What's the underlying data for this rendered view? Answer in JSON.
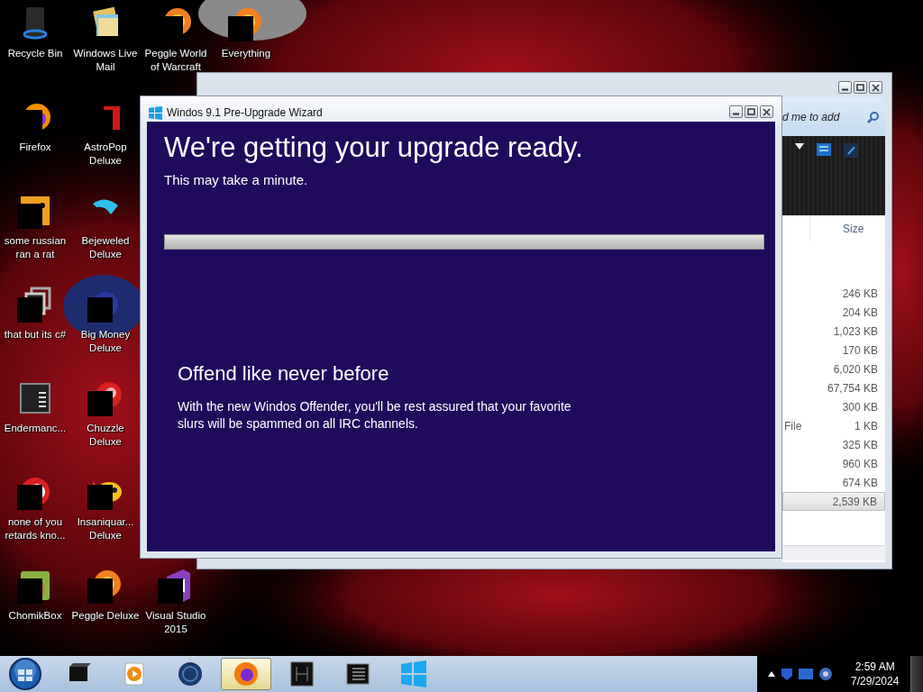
{
  "desktop_icons": [
    [
      {
        "label": "Recycle Bin",
        "kind": "bin",
        "censored": false
      },
      {
        "label": "Windows Live Mail",
        "kind": "mail",
        "censored": false
      },
      {
        "label": "Peggle World of Warcraft",
        "kind": "ring",
        "censored": true
      },
      {
        "label": "Everything",
        "kind": "ring",
        "censored": true
      }
    ],
    [
      {
        "label": "Firefox",
        "kind": "fox",
        "censored": true
      },
      {
        "label": "AstroPop Deluxe",
        "kind": "astro",
        "censored": true
      }
    ],
    [
      {
        "label": "some russian ran a rat",
        "kind": "rat",
        "censored": true
      },
      {
        "label": "Bejeweled Deluxe",
        "kind": "gem",
        "censored": false
      }
    ],
    [
      {
        "label": "that but its c#",
        "kind": "stack",
        "censored": true
      },
      {
        "label": "Big Money Deluxe",
        "kind": "blob",
        "censored": true
      }
    ],
    [
      {
        "label": "Endermanc...",
        "kind": "term",
        "censored": false
      },
      {
        "label": "Chuzzle Deluxe",
        "kind": "red",
        "censored": true
      }
    ],
    [
      {
        "label": "none of you retards kno...",
        "kind": "swirl",
        "censored": true
      },
      {
        "label": "Insaniquar... Deluxe",
        "kind": "fish",
        "censored": true
      }
    ],
    [
      {
        "label": "ChomikBox",
        "kind": "hamster",
        "censored": true
      },
      {
        "label": "Peggle Deluxe",
        "kind": "ring",
        "censored": true
      },
      {
        "label": "Visual Studio 2015",
        "kind": "vs",
        "censored": true
      }
    ]
  ],
  "explorer": {
    "search": {
      "placeholder": "d me to add"
    },
    "columns": [
      "Size"
    ],
    "rows": [
      {
        "size": "246 KB",
        "selected": false
      },
      {
        "size": "204 KB",
        "selected": false
      },
      {
        "size": "1,023 KB",
        "selected": false
      },
      {
        "size": "170 KB",
        "selected": false
      },
      {
        "size": "6,020 KB",
        "selected": false
      },
      {
        "size": "67,754 KB",
        "selected": false
      },
      {
        "size": "300 KB",
        "selected": false
      },
      {
        "column_2": "File",
        "size": "1 KB",
        "selected": false
      },
      {
        "size": "325 KB",
        "selected": false
      },
      {
        "size": "960 KB",
        "selected": false
      },
      {
        "size": "674 KB",
        "selected": false
      },
      {
        "size": "2,539 KB",
        "selected": true
      }
    ]
  },
  "wizard": {
    "title": "Windos 9.1 Pre-Upgrade Wizard",
    "heading": "We're getting your upgrade ready.",
    "subtitle": "This may take a minute.",
    "progress": {
      "level": 1
    },
    "feature_title": "Offend like never before",
    "feature_text": "With the new Windos Offender, you'll be rest assured that your favorite slurs will be spammed on all IRC channels."
  },
  "taskbar": {
    "buttons": [
      {
        "kind": "box",
        "selected": false
      },
      {
        "kind": "media",
        "selected": false
      },
      {
        "kind": "globe",
        "selected": false
      },
      {
        "kind": "fox",
        "selected": true
      },
      {
        "kind": "term",
        "selected": false
      },
      {
        "kind": "notes",
        "selected": false
      },
      {
        "kind": "win",
        "selected": false
      }
    ],
    "clock": {
      "time": "2:59 AM",
      "date": "7/29/2024"
    }
  }
}
